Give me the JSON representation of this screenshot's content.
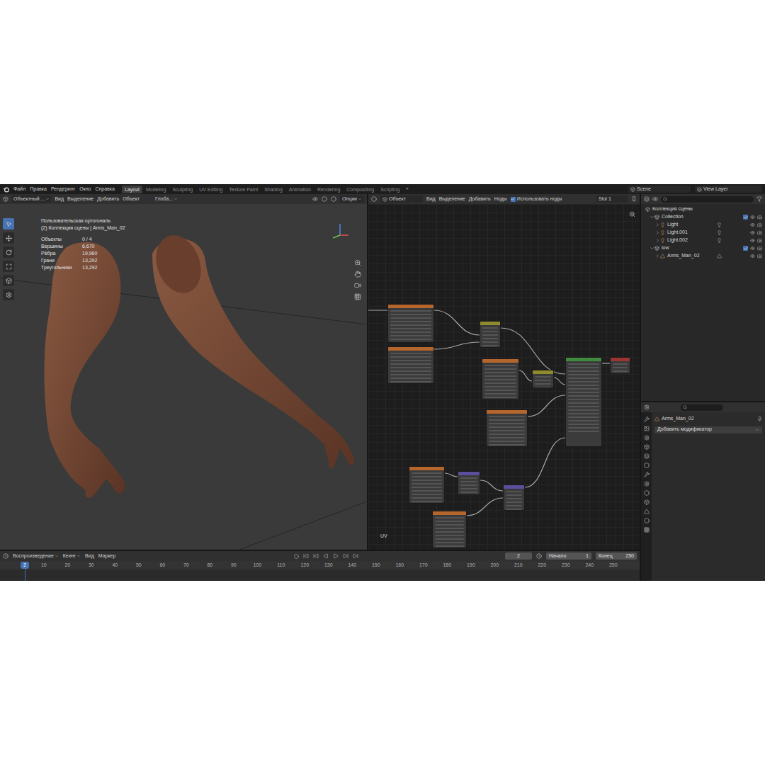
{
  "menu": [
    "Файл",
    "Правка",
    "Рендеринг",
    "Окно",
    "Справка"
  ],
  "workspaces": [
    {
      "label": "Layout",
      "selected": true
    },
    {
      "label": "Modeling",
      "selected": false
    },
    {
      "label": "Sculpting",
      "selected": false
    },
    {
      "label": "UV Editing",
      "selected": false
    },
    {
      "label": "Texture Paint",
      "selected": false
    },
    {
      "label": "Shading",
      "selected": false
    },
    {
      "label": "Animation",
      "selected": false
    },
    {
      "label": "Rendering",
      "selected": false
    },
    {
      "label": "Compositing",
      "selected": false
    },
    {
      "label": "Scripting",
      "selected": false
    }
  ],
  "add_workspace": "+",
  "scene": "Scene",
  "view_layer": "View Layer",
  "viewport": {
    "mode": "Объектный ...",
    "menus": [
      "Вид",
      "Выделение",
      "Добавить",
      "Объект"
    ],
    "orientation": "Глоба...",
    "options": "Опции",
    "view_name": "Пользовательская ортогональ",
    "collection": "(2) Коллекция сцены | Arms_Man_02",
    "stats": [
      {
        "label": "Объекты",
        "value": "0 / 4"
      },
      {
        "label": "Вершины",
        "value": "6,670"
      },
      {
        "label": "Рёбра",
        "value": "19,960"
      },
      {
        "label": "Грани",
        "value": "13,292"
      },
      {
        "label": "Треугольники",
        "value": "13,292"
      }
    ]
  },
  "node_editor": {
    "type": "Объект",
    "menus": [
      "Вид",
      "Выделение",
      "Добавить",
      "Ноды"
    ],
    "use_nodes": {
      "label": "Использовать ноды",
      "checked": true
    },
    "slot": "Slot 1",
    "corner_label": "UV",
    "nodes": [
      {
        "color": "#b5662d"
      },
      {
        "color": "#b5662d"
      },
      {
        "color": "#8f8a2e"
      },
      {
        "color": "#b5662d"
      },
      {
        "color": "#8f8a2e"
      },
      {
        "color": "#3f8a3f"
      },
      {
        "color": "#9c3434"
      },
      {
        "color": "#b5662d"
      },
      {
        "color": "#b5662d"
      },
      {
        "color": "#5a4f9c"
      },
      {
        "color": "#5a4f9c"
      },
      {
        "color": "#b5662d"
      }
    ]
  },
  "outliner": {
    "root": "Коллекция сцены",
    "collections": [
      {
        "name": "Collection",
        "checked": true,
        "expanded": true,
        "children": [
          {
            "name": "Light",
            "kind": "light",
            "expanded": false
          },
          {
            "name": "Light.001",
            "kind": "light",
            "expanded": false
          },
          {
            "name": "Light.002",
            "kind": "light",
            "expanded": false
          }
        ]
      },
      {
        "name": "low",
        "checked": true,
        "expanded": true,
        "children": [
          {
            "name": "Arms_Man_02",
            "kind": "mesh",
            "expanded": false
          }
        ]
      }
    ]
  },
  "properties": {
    "object": "Arms_Man_02",
    "add_modifier": "Добавить модификатор"
  },
  "timeline": {
    "menus": [
      {
        "label": "Воспроизведение",
        "dropdown": true
      },
      {
        "label": "Кеинг",
        "dropdown": true
      },
      {
        "label": "Вид",
        "dropdown": false
      },
      {
        "label": "Маркер",
        "dropdown": false
      }
    ],
    "current_frame": "2",
    "start_label": "Начало",
    "start": "1",
    "end_label": "Конец",
    "end": "250",
    "ruler": [
      "10",
      "20",
      "30",
      "40",
      "50",
      "60",
      "70",
      "80",
      "90",
      "100",
      "110",
      "120",
      "130",
      "140",
      "150",
      "160",
      "170",
      "180",
      "190",
      "200",
      "210",
      "220",
      "230",
      "240",
      "250"
    ]
  }
}
